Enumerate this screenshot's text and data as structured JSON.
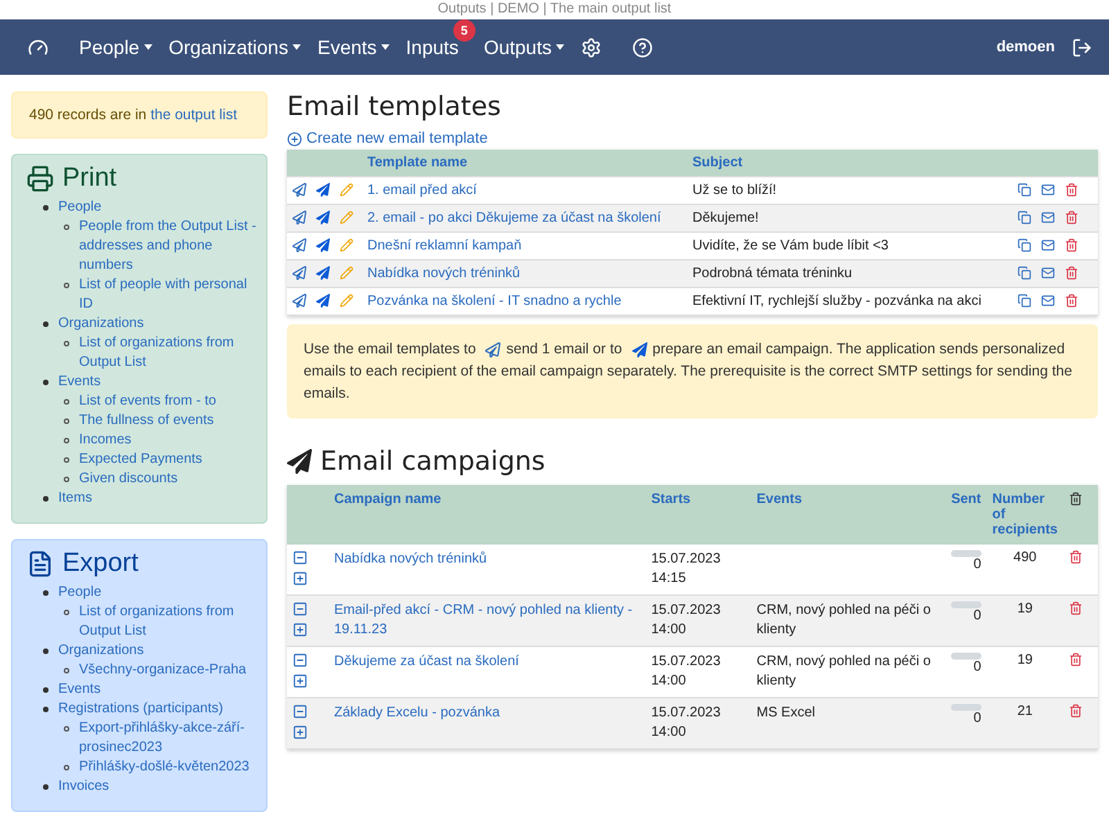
{
  "browser_title": "Outputs | DEMO | The main output list",
  "nav": {
    "items": [
      {
        "label": "People",
        "dropdown": true
      },
      {
        "label": "Organizations",
        "dropdown": true
      },
      {
        "label": "Events",
        "dropdown": true
      },
      {
        "label": "Inputs",
        "dropdown": false,
        "badge": "5"
      },
      {
        "label": "Outputs",
        "dropdown": true
      }
    ],
    "user": "demoen"
  },
  "records_note": {
    "text": "490 records are in ",
    "link": "the output list"
  },
  "sidebar": [
    {
      "kind": "print",
      "title": "Print",
      "items": [
        {
          "label": "People",
          "children": [
            {
              "label": "People from the Output List - addresses and phone numbers"
            },
            {
              "label": "List of people with personal ID"
            }
          ]
        },
        {
          "label": "Organizations",
          "children": [
            {
              "label": "List of organizations from Output List"
            }
          ]
        },
        {
          "label": "Events",
          "children": [
            {
              "label": "List of events from - to"
            },
            {
              "label": "The fullness of events"
            },
            {
              "label": "Incomes"
            },
            {
              "label": "Expected Payments"
            },
            {
              "label": "Given discounts"
            }
          ]
        },
        {
          "label": "Items"
        }
      ]
    },
    {
      "kind": "export",
      "title": "Export",
      "items": [
        {
          "label": "People",
          "children": [
            {
              "label": "List of organizations from Output List"
            }
          ]
        },
        {
          "label": "Organizations",
          "children": [
            {
              "label": "Všechny-organizace-Praha"
            }
          ]
        },
        {
          "label": "Events"
        },
        {
          "label": "Registrations (participants)",
          "children": [
            {
              "label": "Export-přihlášky-akce-září-prosinec2023"
            },
            {
              "label": "Přihlášky-došlé-květen2023"
            }
          ]
        },
        {
          "label": "Invoices"
        }
      ]
    }
  ],
  "templates": {
    "title": "Email templates",
    "create_link": "Create new email template",
    "columns": [
      "Template name",
      "Subject"
    ],
    "rows": [
      {
        "name": "1. email před akcí",
        "subject": "Už se to blíží!"
      },
      {
        "name": "2. email - po akci Děkujeme za účast na školení",
        "subject": "Děkujeme!"
      },
      {
        "name": "Dnešní reklamní kampaň",
        "subject": "Uvidíte, že se Vám bude líbit <3"
      },
      {
        "name": "Nabídka nových tréninků",
        "subject": "Podrobná témata tréninku"
      },
      {
        "name": "Pozvánka na školení - IT snadno a rychle",
        "subject": "Efektivní IT, rychlejší služby - pozvánka na akci"
      }
    ]
  },
  "info": {
    "part1": "Use the email templates to",
    "part2": "send 1 email or to",
    "part3": "prepare an email campaign. The application sends personalized emails to each recipient of the email campaign separately. The prerequisite is the correct SMTP settings for sending the emails."
  },
  "campaigns": {
    "title": "Email campaigns",
    "columns": [
      "Campaign name",
      "Starts",
      "Events",
      "Sent",
      "Number of recipients"
    ],
    "rows": [
      {
        "name": "Nabídka nových tréninků",
        "date": "15.07.2023",
        "time": "14:15",
        "level": 0,
        "sent": "0",
        "recipients": "490"
      },
      {
        "name": "Email-před akcí - CRM - nový pohled na klienty - 19.11.23",
        "date": "15.07.2023",
        "time": "14:00",
        "events": "CRM, nový pohled na péči o klienty",
        "level": 0,
        "sent": "0",
        "recipients": "19"
      },
      {
        "name": "Děkujeme za účast na školení",
        "date": "15.07.2023",
        "time": "14:00",
        "events": "CRM, nový pohled na péči o klienty",
        "level": 0,
        "sent": "0",
        "recipients": "19"
      },
      {
        "name": "Základy Excelu - pozvánka",
        "date": "15.07.2023",
        "time": "14:00",
        "events": "MS Excel",
        "level": 0,
        "sent": "0",
        "recipients": "21"
      }
    ]
  }
}
